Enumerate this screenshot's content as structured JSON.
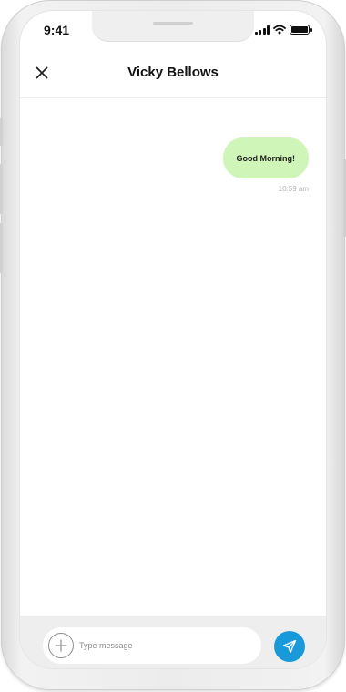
{
  "status_bar": {
    "time": "9:41",
    "icons": [
      "cellular-signal-icon",
      "wifi-icon",
      "battery-icon"
    ]
  },
  "header": {
    "title": "Vicky Bellows",
    "close_icon": "close-icon"
  },
  "messages": [
    {
      "text": "Good Morning!",
      "time": "10:59 am",
      "direction": "outgoing"
    }
  ],
  "composer": {
    "placeholder": "Type message",
    "value": "",
    "add_icon": "plus-circle-icon",
    "send_icon": "send-icon"
  },
  "colors": {
    "outgoing_bubble": "#cff5b8",
    "send_button": "#1a99da",
    "composer_bar": "#eeeeee",
    "time_text": "#b4b4b4"
  }
}
